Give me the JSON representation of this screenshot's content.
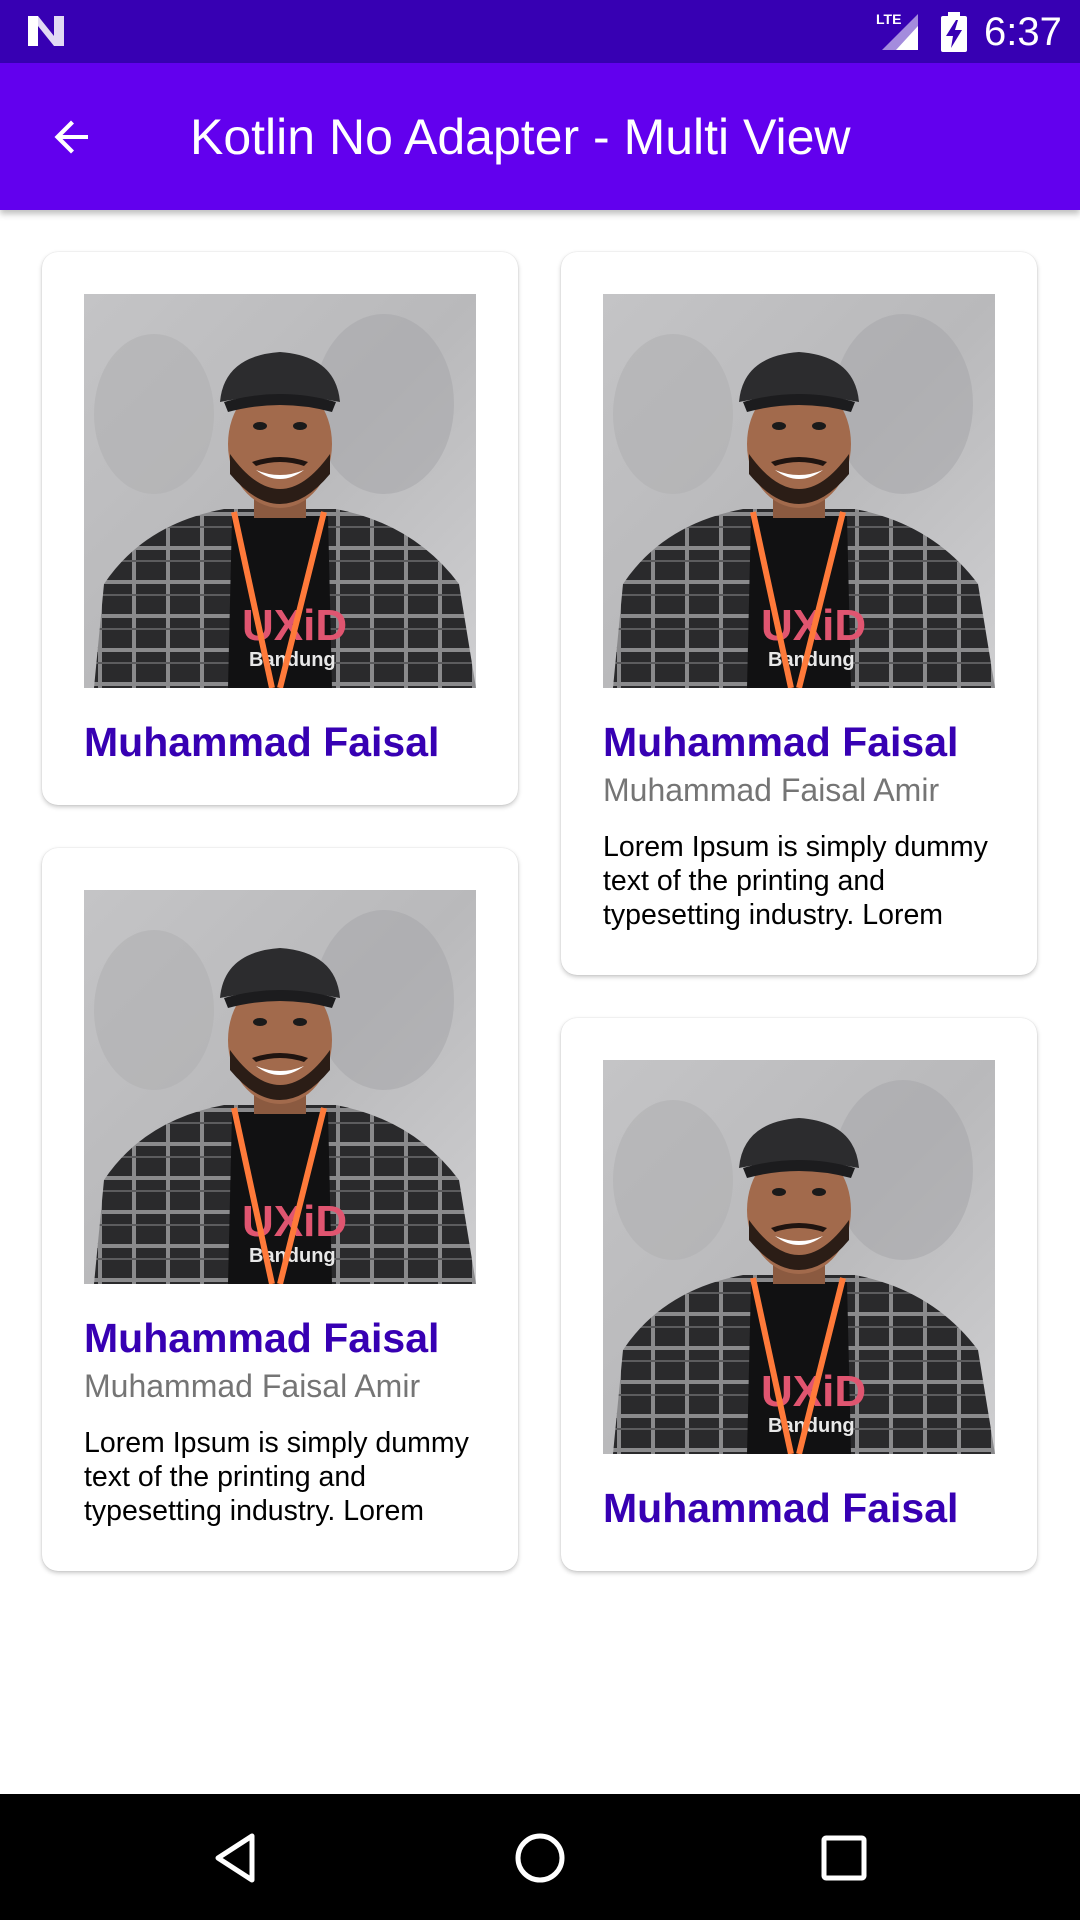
{
  "status_bar": {
    "time": "6:37",
    "network_label": "LTE",
    "icons": [
      "n-logo-icon",
      "lte-signal-icon",
      "battery-charging-icon"
    ],
    "background_color": "#3700b3"
  },
  "app_bar": {
    "title": "Kotlin No Adapter - Multi View",
    "back_icon": "arrow-back-icon",
    "background_color": "#6200ee"
  },
  "cards": [
    {
      "name": "Muhammad Faisal"
    },
    {
      "name": "Muhammad Faisal",
      "subtitle": "Muhammad Faisal Amir",
      "description": "Lorem Ipsum is simply dummy text of the printing and typesetting industry. Lorem"
    },
    {
      "name": "Muhammad Faisal",
      "subtitle": "Muhammad Faisal Amir",
      "description": "Lorem Ipsum is simply dummy text of the printing and typesetting industry. Lorem"
    },
    {
      "name": "Muhammad Faisal"
    }
  ],
  "nav_bar": {
    "icons": [
      "back-triangle-icon",
      "home-circle-icon",
      "recents-square-icon"
    ]
  },
  "colors": {
    "name_text": "#3700b3",
    "subtitle_text": "#757575"
  }
}
